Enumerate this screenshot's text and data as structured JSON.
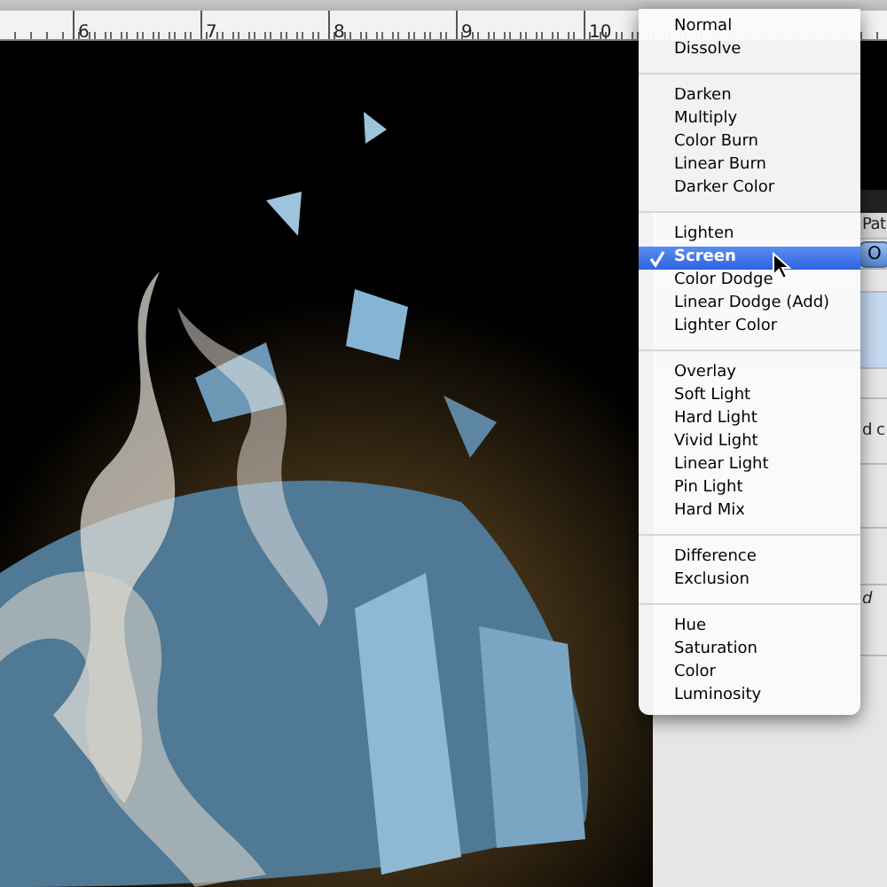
{
  "ruler": {
    "labels": [
      "6",
      "7",
      "8",
      "9",
      "10"
    ]
  },
  "panel": {
    "tab": "Pat",
    "button": "O",
    "notes": [
      "d c",
      "d"
    ]
  },
  "blend_menu": {
    "groups": [
      [
        {
          "label": "Normal",
          "selected": false
        },
        {
          "label": "Dissolve",
          "selected": false
        }
      ],
      [
        {
          "label": "Darken",
          "selected": false
        },
        {
          "label": "Multiply",
          "selected": false
        },
        {
          "label": "Color Burn",
          "selected": false
        },
        {
          "label": "Linear Burn",
          "selected": false
        },
        {
          "label": "Darker Color",
          "selected": false
        }
      ],
      [
        {
          "label": "Lighten",
          "selected": false
        },
        {
          "label": "Screen",
          "selected": true
        },
        {
          "label": "Color Dodge",
          "selected": false
        },
        {
          "label": "Linear Dodge (Add)",
          "selected": false
        },
        {
          "label": "Lighter Color",
          "selected": false
        }
      ],
      [
        {
          "label": "Overlay",
          "selected": false
        },
        {
          "label": "Soft Light",
          "selected": false
        },
        {
          "label": "Hard Light",
          "selected": false
        },
        {
          "label": "Vivid Light",
          "selected": false
        },
        {
          "label": "Linear Light",
          "selected": false
        },
        {
          "label": "Pin Light",
          "selected": false
        },
        {
          "label": "Hard Mix",
          "selected": false
        }
      ],
      [
        {
          "label": "Difference",
          "selected": false
        },
        {
          "label": "Exclusion",
          "selected": false
        }
      ],
      [
        {
          "label": "Hue",
          "selected": false
        },
        {
          "label": "Saturation",
          "selected": false
        },
        {
          "label": "Color",
          "selected": false
        },
        {
          "label": "Luminosity",
          "selected": false
        }
      ]
    ]
  }
}
